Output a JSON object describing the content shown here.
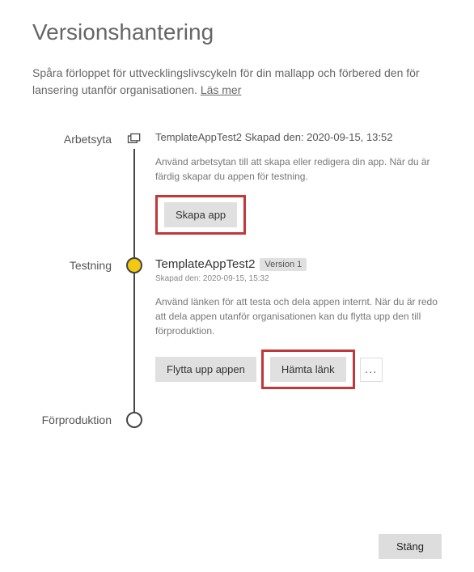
{
  "title": "Versionshantering",
  "description": "Spåra förloppet för uttvecklingslivscykeln för din mallapp och förbered den för lansering utanför organisationen. ",
  "learn_more": "Läs mer",
  "stages": {
    "workspace": {
      "label": "Arbetsyta",
      "header": "TemplateAppTest2 Skapad den: 2020-09-15, 13:52",
      "desc": "Använd arbetsytan till att skapa eller redigera din app. När du är färdig skapar du appen för testning.",
      "create_app": "Skapa app"
    },
    "testing": {
      "label": "Testning",
      "app_name": "TemplateAppTest2",
      "version": "Version 1",
      "created": "Skapad den: 2020-09-15, 15:32",
      "desc": "Använd länken för att testa och dela appen internt. När du är redo att dela appen utanför organisationen kan du flytta upp den till förproduktion.",
      "promote": "Flytta upp appen",
      "get_link": "Hämta länk"
    },
    "preprod": {
      "label": "Förproduktion"
    }
  },
  "close": "Stäng"
}
